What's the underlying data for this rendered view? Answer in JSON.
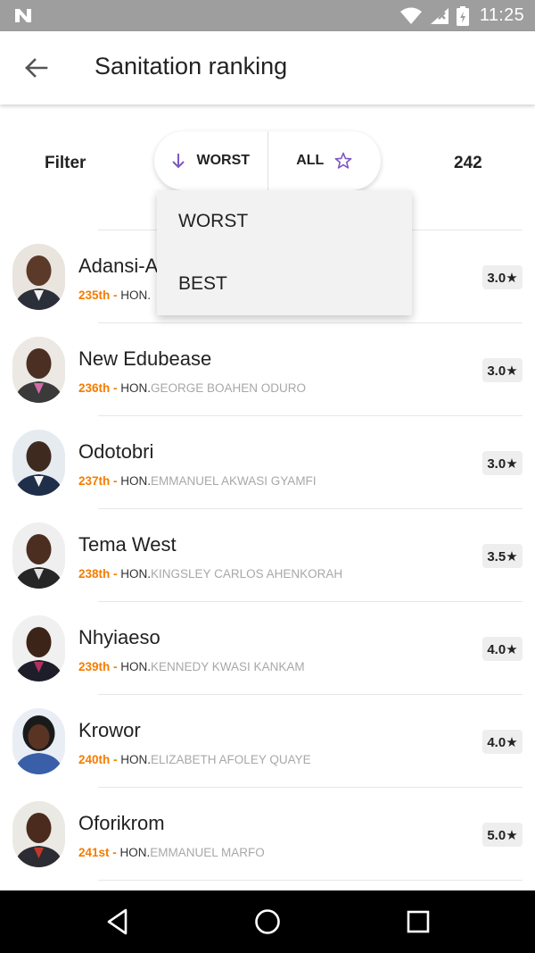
{
  "status_bar": {
    "time": "11:25",
    "icons": [
      "n-notification-icon",
      "wifi-icon",
      "signal-icon",
      "battery-icon"
    ]
  },
  "app_bar": {
    "title": "Sanitation ranking",
    "back_icon": "arrow-back-icon"
  },
  "filter": {
    "label": "Filter",
    "sort_label": "WORST",
    "sort_icon": "arrow-down-icon",
    "scope_label": "ALL",
    "scope_icon": "star-outline-icon",
    "count": "242"
  },
  "dropdown": {
    "options": [
      "WORST",
      "BEST"
    ]
  },
  "colors": {
    "accent": "#7e57c2",
    "rank": "#f57c00",
    "status_bar": "#9e9e9e"
  },
  "list": [
    {
      "constituency": "Adansi-A",
      "rank": "235th -",
      "hon": "HON.",
      "name": "",
      "rating": "3.0★"
    },
    {
      "constituency": "New Edubease",
      "rank": "236th -",
      "hon": "HON.",
      "name": "GEORGE BOAHEN ODURO",
      "rating": "3.0★"
    },
    {
      "constituency": "Odotobri",
      "rank": "237th -",
      "hon": "HON.",
      "name": "EMMANUEL AKWASI GYAMFI",
      "rating": "3.0★"
    },
    {
      "constituency": "Tema West",
      "rank": "238th -",
      "hon": "HON.",
      "name": "KINGSLEY CARLOS AHENKORAH",
      "rating": "3.5★"
    },
    {
      "constituency": "Nhyiaeso",
      "rank": "239th -",
      "hon": "HON.",
      "name": "KENNEDY KWASI KANKAM",
      "rating": "4.0★"
    },
    {
      "constituency": "Krowor",
      "rank": "240th -",
      "hon": "HON.",
      "name": "ELIZABETH AFOLEY QUAYE",
      "rating": "4.0★"
    },
    {
      "constituency": "Oforikrom",
      "rank": "241st -",
      "hon": "HON.",
      "name": "EMMANUEL MARFO",
      "rating": "5.0★"
    }
  ]
}
